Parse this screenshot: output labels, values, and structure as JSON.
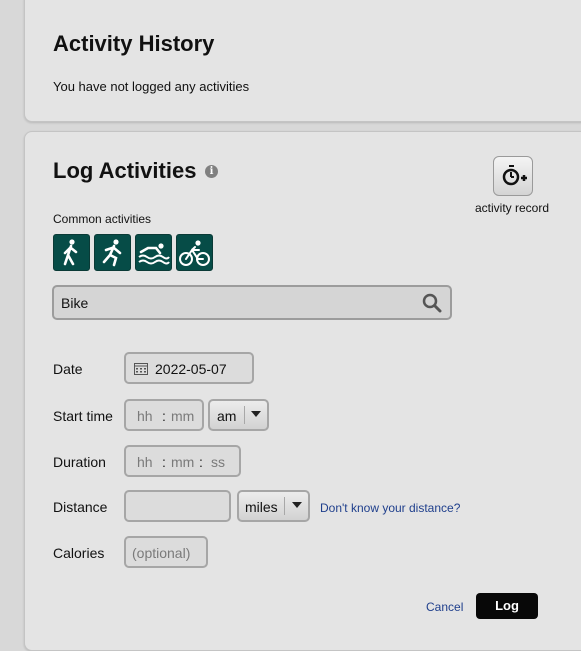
{
  "history": {
    "title": "Activity History",
    "empty_message": "You have not logged any activities"
  },
  "log": {
    "title": "Log Activities",
    "info_icon": "info-icon",
    "activity_record_label": "activity record",
    "common_activities_label": "Common activities",
    "activity_icons": [
      "walk-icon",
      "run-icon",
      "swim-icon",
      "bike-icon"
    ],
    "search": {
      "value": "Bike",
      "icon": "search-icon"
    },
    "fields": {
      "date": {
        "label": "Date",
        "value": "2022-05-07"
      },
      "start_time": {
        "label": "Start time",
        "hh": "hh",
        "mm": "mm",
        "sep": ":",
        "ampm": "am"
      },
      "duration": {
        "label": "Duration",
        "hh": "hh",
        "mm": "mm",
        "ss": "ss",
        "sep": ":"
      },
      "distance": {
        "label": "Distance",
        "value": "",
        "unit": "miles",
        "help_link": "Don't know your distance?"
      },
      "calories": {
        "label": "Calories",
        "placeholder": "(optional)"
      }
    },
    "cancel_label": "Cancel",
    "log_label": "Log"
  },
  "colors": {
    "activity_button_bg": "#064c47",
    "link": "#1f3f8c",
    "primary_button": "#080808",
    "panel_bg": "#e4e4e4"
  }
}
